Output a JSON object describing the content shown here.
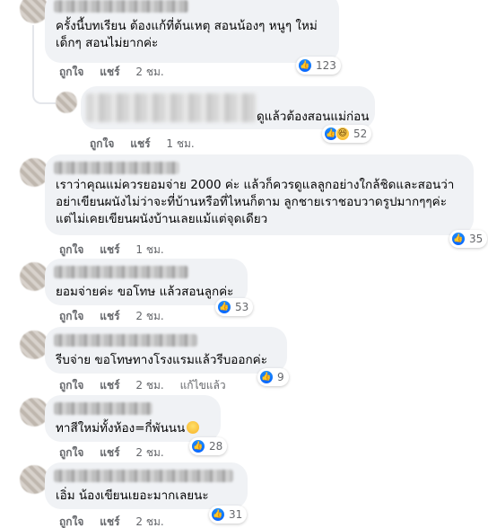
{
  "comments": [
    {
      "text": "ครั้งนี้บทเรียน ต้องแก้ที่ต้นเหตุ สอนน้องๆ หนูๆ ใหม่\nเด็กๆ สอนไม่ยากค่ะ",
      "like_label": "ถูกใจ",
      "share_label": "แชร์",
      "time": "2 ชม.",
      "reactions": {
        "types": [
          "like-icon"
        ],
        "count": "123"
      }
    },
    {
      "text": "ดูแล้วต้องสอนแม่ก่อน",
      "like_label": "ถูกใจ",
      "share_label": "แชร์",
      "time": "1 ชม.",
      "reactions": {
        "types": [
          "like-icon",
          "haha-icon"
        ],
        "count": "52"
      }
    },
    {
      "text": "เราว่าคุณแม่ควรยอมจ่าย 2000 ค่ะ แล้วก็ควรดูแลลูกอย่างใกล้ชิดและสอนว่า\nอย่าเขียนผนังไม่ว่าจะที่บ้านหรือที่ไหนก็ตาม ลูกชายเราชอบวาดรูปมากๆๆค่ะ\nแต่ไม่เคยเขียนผนังบ้านเลยแม้แต่จุดเดียว",
      "like_label": "ถูกใจ",
      "share_label": "แชร์",
      "time": "1 ชม.",
      "reactions": {
        "types": [
          "like-icon"
        ],
        "count": "35"
      }
    },
    {
      "text": "ยอมจ่ายค่ะ ขอโทษ แล้วสอนลูกค่ะ",
      "like_label": "ถูกใจ",
      "share_label": "แชร์",
      "time": "2 ชม.",
      "reactions": {
        "types": [
          "like-icon"
        ],
        "count": "53"
      }
    },
    {
      "text": "รีบจ่าย ขอโทษทางโรงแรมแล้วรีบออกค่ะ",
      "like_label": "ถูกใจ",
      "share_label": "แชร์",
      "time": "2 ชม.",
      "edited_label": "แก้ไขแล้ว",
      "reactions": {
        "types": [
          "like-icon"
        ],
        "count": "9"
      }
    },
    {
      "text": "ทาสีใหม่ทั้งห้อง=กี่พันนน",
      "emoji": "sad-face-emoji",
      "like_label": "ถูกใจ",
      "share_label": "แชร์",
      "time": "2 ชม.",
      "reactions": {
        "types": [
          "like-icon"
        ],
        "count": "28"
      }
    },
    {
      "text": "เอิ่ม น้องเขียนเยอะมากเลยนะ",
      "like_label": "ถูกใจ",
      "share_label": "แชร์",
      "time": "2 ชม.",
      "reactions": {
        "types": [
          "like-icon"
        ],
        "count": "31"
      }
    }
  ],
  "colors": {
    "bubble": "#f0f2f5",
    "meta_text": "#65676b",
    "like_blue": "#0866ff"
  }
}
